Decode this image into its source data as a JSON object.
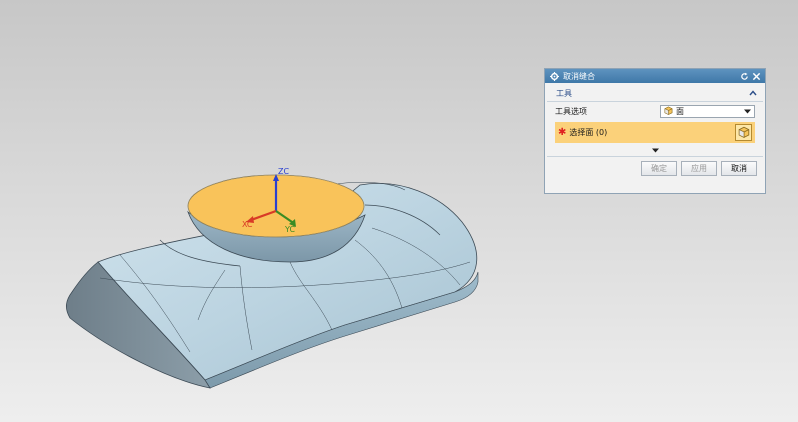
{
  "viewport": {
    "axes": {
      "z": "ZC",
      "x": "XC",
      "y": "YC"
    },
    "colors": {
      "body": "#b9d2df",
      "selected_face": "#f9c35a",
      "x_axis": "#d93a26",
      "y_axis": "#3b8c24",
      "z_axis": "#2a3fd0"
    }
  },
  "dialog": {
    "title": "取消缝合",
    "icons": {
      "settings": "gear-icon",
      "reset": "reset-icon",
      "close": "close-icon"
    },
    "section": {
      "label": "工具",
      "collapse_icon": "chevron-up-icon"
    },
    "tool_option": {
      "label": "工具选项",
      "value": "面",
      "icon": "face-cube-icon"
    },
    "select": {
      "label": "选择面 (0)",
      "required_icon": "asterisk-icon",
      "button_icon": "face-cube-icon"
    },
    "buttons": {
      "ok": "确定",
      "apply": "应用",
      "cancel": "取消"
    }
  }
}
